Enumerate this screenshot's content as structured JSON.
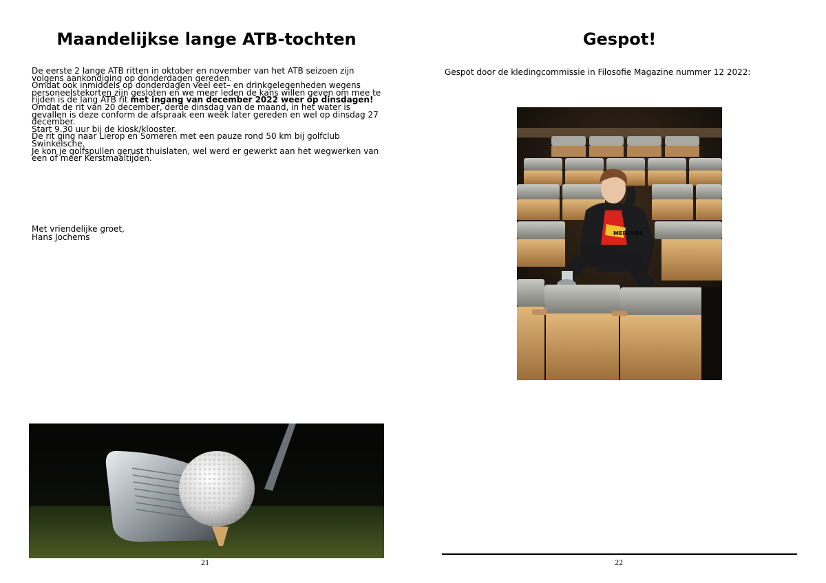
{
  "left_page": {
    "title": "Maandelijkse lange ATB-tochten",
    "paragraph_lines": [
      "De eerste 2 lange ATB ritten in oktober en november van het ATB seizoen zijn volgens aankondiging op donderdagen gereden.",
      "Omdat ook inmiddels op donderdagen veel eet– en drinkgelegenheden wegens personeelstekorten zijn gesloten en we meer leden de kans willen geven om mee te rijden is de lang ATB rit "
    ],
    "bold_text": "met ingang van december 2022 weer op dinsdagen!",
    "rest_lines": [
      "Omdat de rit van 20 december, derde dinsdag van de maand,  in het water is gevallen is deze conform de afspraak een week later gereden en wel op dinsdag 27 december.",
      "Start 9.30 uur bij de kiosk/klooster.",
      "De rit ging naar Lierop en Someren met een pauze rond  50 km bij golfclub Swinkelsche.",
      "Je kon je golfspullen gerust thuislaten, wel werd er gewerkt aan het wegwerken van een of meer Kerstmaaltijden."
    ],
    "greeting": "Met vriendelijke groet,",
    "signature": "Hans Jochems",
    "page_number": "21"
  },
  "right_page": {
    "title": "Gespot!",
    "intro": "Gespot door de kledingcommissie in Filosofie Magazine nummer 12 2022:",
    "page_number": "22",
    "shirt_print": "MERCURE"
  }
}
